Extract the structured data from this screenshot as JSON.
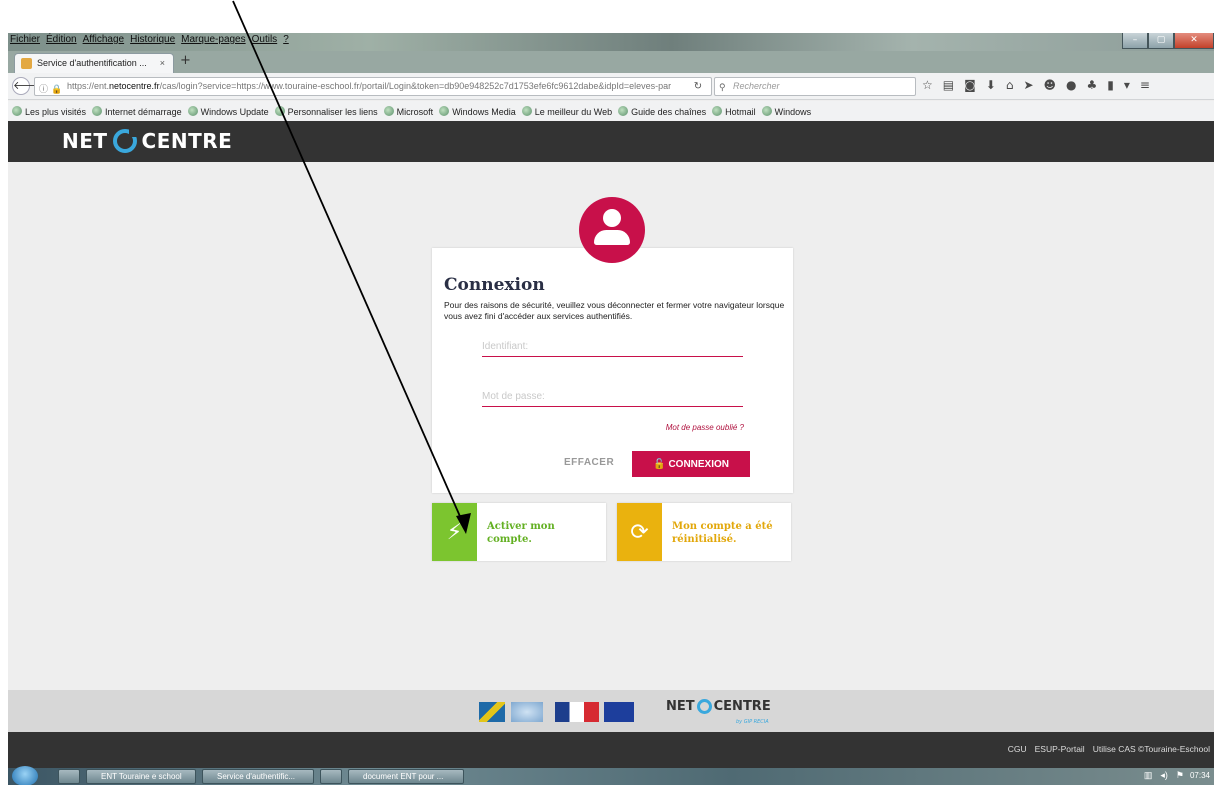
{
  "browser": {
    "menu": [
      "Fichier",
      "Édition",
      "Affichage",
      "Historique",
      "Marque-pages",
      "Outils",
      "?"
    ],
    "tab_title": "Service d'authentification ...",
    "tab_close": "×",
    "new_tab": "+",
    "url_prefix": "https://ent.",
    "url_domain": "netocentre.fr",
    "url_rest": "/cas/login?service=https://www.touraine-eschool.fr/portail/Login&token=db90e948252c7d1753efe6fc9612dabe&idpId=eleves-par",
    "search_placeholder": "Rechercher",
    "bookmarks": [
      "Les plus visités",
      "Internet démarrage",
      "Windows Update",
      "Personnaliser les liens",
      "Microsoft",
      "Windows Media",
      "Le meilleur du Web",
      "Guide des chaînes",
      "Hotmail",
      "Windows"
    ]
  },
  "header": {
    "logo_left": "NET",
    "logo_right": "CENTRE"
  },
  "login": {
    "title": "Connexion",
    "message": "Pour des raisons de sécurité, veuillez vous déconnecter et fermer votre navigateur lorsque vous avez fini d'accéder aux services authentifiés.",
    "username_placeholder": "Identifiant:",
    "password_placeholder": "Mot de passe:",
    "forgot_link": "Mot de passe oublié ?",
    "clear_button": "EFFACER",
    "login_button": "CONNEXION"
  },
  "actions": {
    "activate": "Activer mon compte.",
    "reset": "Mon compte a été réinitialisé."
  },
  "footer": {
    "logo_left": "NET",
    "logo_right": "CENTRE",
    "by_label": "by GIP RECIA",
    "links": [
      "CGU",
      "ESUP-Portail",
      "Utilise CAS ©Touraine-Eschool"
    ]
  },
  "taskbar": {
    "items": [
      "ENT Touraine e school",
      "Service d'authentific...",
      "document ENT pour ..."
    ],
    "clock": "07:34"
  },
  "colors": {
    "accent": "#c8104a",
    "header_bg": "#333333",
    "activate_green": "#7cc52f",
    "reset_yellow": "#eab20e",
    "logo_blue": "#3aa8dd"
  }
}
